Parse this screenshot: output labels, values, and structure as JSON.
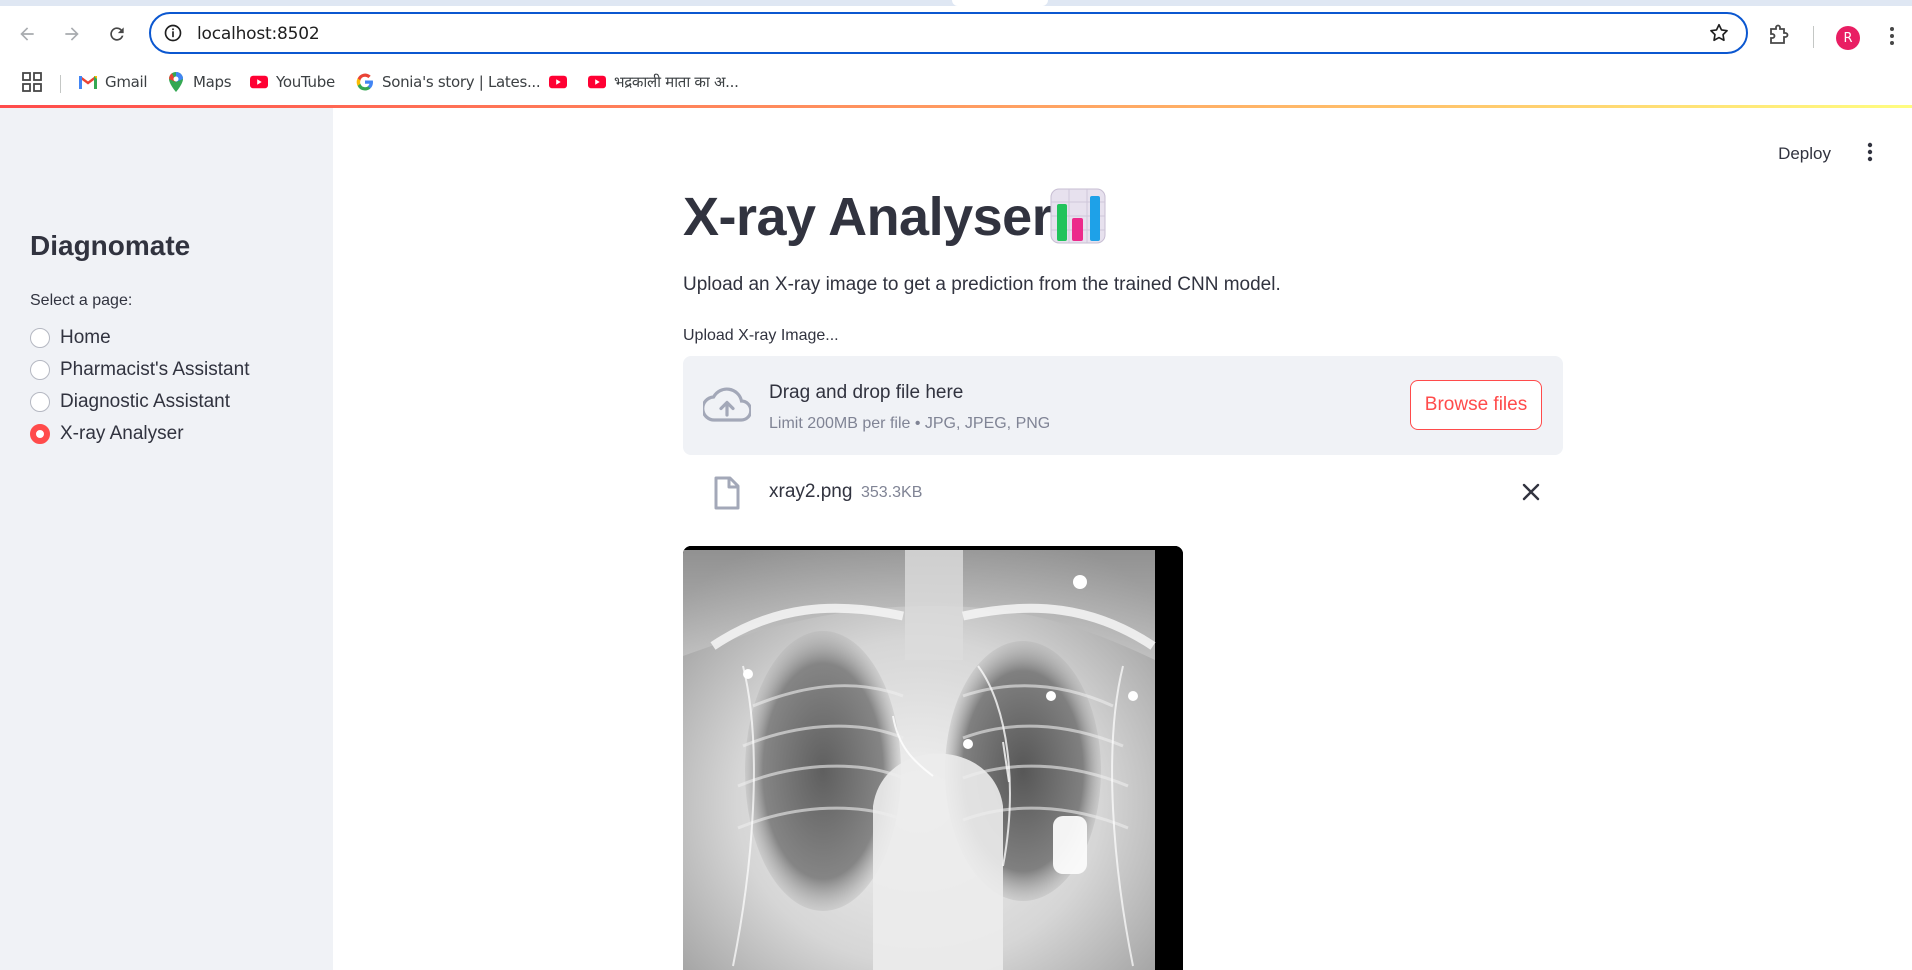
{
  "browser": {
    "url": "localhost:8502",
    "profile_initial": "R",
    "bookmarks": [
      {
        "label": "Gmail",
        "icon": "gmail-icon"
      },
      {
        "label": "Maps",
        "icon": "maps-icon"
      },
      {
        "label": "YouTube",
        "icon": "youtube-icon"
      },
      {
        "label": "Sonia's story | Lates...",
        "icon": "google-icon"
      },
      {
        "label": "",
        "icon": "youtube-icon"
      },
      {
        "label": "भद्रकाली माता का अ...",
        "icon": "youtube-icon"
      }
    ]
  },
  "sidebar": {
    "title": "Diagnomate",
    "select_label": "Select a page:",
    "pages": [
      {
        "label": "Home",
        "selected": false
      },
      {
        "label": "Pharmacist's Assistant",
        "selected": false
      },
      {
        "label": "Diagnostic Assistant",
        "selected": false
      },
      {
        "label": "X-ray Analyser",
        "selected": true
      }
    ]
  },
  "header": {
    "deploy_label": "Deploy"
  },
  "main": {
    "title": "X-ray Analyser",
    "title_icon": "bar-chart-emoji",
    "subtitle": "Upload an X-ray image to get a prediction from the trained CNN model.",
    "uploader": {
      "label": "Upload X-ray Image...",
      "drop_text": "Drag and drop file here",
      "limit_text": "Limit 200MB per file • JPG, JPEG, PNG",
      "browse_label": "Browse files"
    },
    "uploaded_file": {
      "name": "xray2.png",
      "size": "353.3KB"
    }
  },
  "colors": {
    "accent": "#ff4b4b",
    "sidebar_bg": "#f0f2f6",
    "text": "#31333f",
    "muted": "#808495",
    "omnibox_border": "#0b57d0"
  }
}
